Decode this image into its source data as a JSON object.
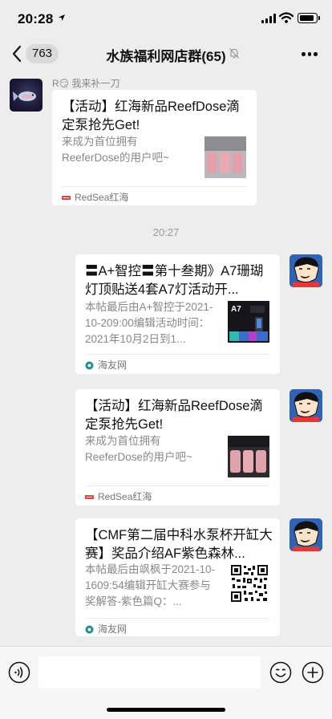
{
  "status_bar": {
    "time": "20:28"
  },
  "nav": {
    "unread_count": "763",
    "title": "水族福利网店群(65)"
  },
  "messages": [
    {
      "sender": "R😏 我来补一刀",
      "title": "【活动】红海新品ReefDose滴定泵抢先Get!",
      "desc": "来成为首位拥有ReeferDose的用户吧~",
      "source": "RedSea红海"
    },
    {
      "title": "〓A+智控〓第十叁期》A7珊瑚灯顶贴送4套A7灯活动开...",
      "desc": "本帖最后由A+智控于2021-10-209:00编辑活动时间：2021年10月2日到1...",
      "source": "海友网",
      "thumb_text": "A7"
    },
    {
      "title": "【活动】红海新品ReefDose滴定泵抢先Get!",
      "desc": "来成为首位拥有ReeferDose的用户吧~",
      "source": "RedSea红海"
    },
    {
      "title": "【CMF第二届中科水泵杯开缸大赛】奖品介绍AF紫色森林...",
      "desc": "本帖最后由飒枫于2021-10-1609:54编辑开缸大赛参与奖解答-紫色篇Q：...",
      "source": "海友网"
    }
  ],
  "time_divider": "20:27",
  "icons": {
    "back": "chevron-left-icon",
    "mute": "bell-off-icon",
    "more": "more-dots-icon",
    "voice": "voice-icon",
    "emoji": "emoji-icon",
    "plus": "plus-icon"
  },
  "colors": {
    "background": "#ededed",
    "card": "#ffffff",
    "accent": "#e8403b"
  }
}
